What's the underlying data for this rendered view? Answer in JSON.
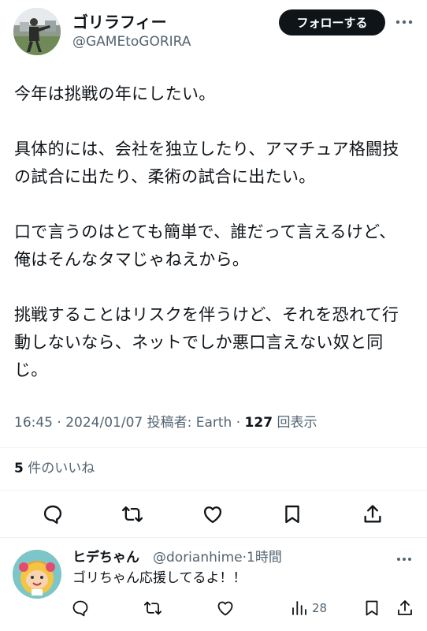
{
  "tweet": {
    "author_name": "ゴリラフィー",
    "author_handle": "@GAMEtoGORIRA",
    "follow_label": "フォローする",
    "lines": [
      "今年は挑戦の年にしたい。",
      "",
      "具体的には、会社を独立したり、アマチュア格闘技",
      "の試合に出たり、柔術の試合に出たい。",
      "",
      "口で言うのはとても簡単で、誰だって言えるけど、",
      "俺はそんなタマじゃねえから。",
      "",
      "挑戦することはリスクを伴うけど、それを恐れて行",
      "動しないなら、ネットでしか悪口言えない奴と同",
      "じ。"
    ],
    "time": "16:45",
    "sep1": " · ",
    "date": "2024/01/07",
    "source": " 投稿者: Earth",
    "sep2": " · ",
    "views": "127",
    "views_label": " 回表示",
    "likes_count": "5",
    "likes_label": " 件のいいね"
  },
  "reply": {
    "author_name": "ヒデちゃん",
    "author_handle": "@dorianhime",
    "time_sep": "·",
    "time": "1時間",
    "text": "ゴリちゃん応援してるよ！！",
    "views_count": "28"
  },
  "icons": [
    "reply-icon",
    "retweet-icon",
    "like-icon",
    "bookmark-icon",
    "share-icon",
    "views-icon",
    "more-icon"
  ],
  "colors": {
    "text": "#0f1419",
    "secondary": "#536471",
    "divider": "#eff3f4",
    "follow_bg": "#0f1419"
  }
}
